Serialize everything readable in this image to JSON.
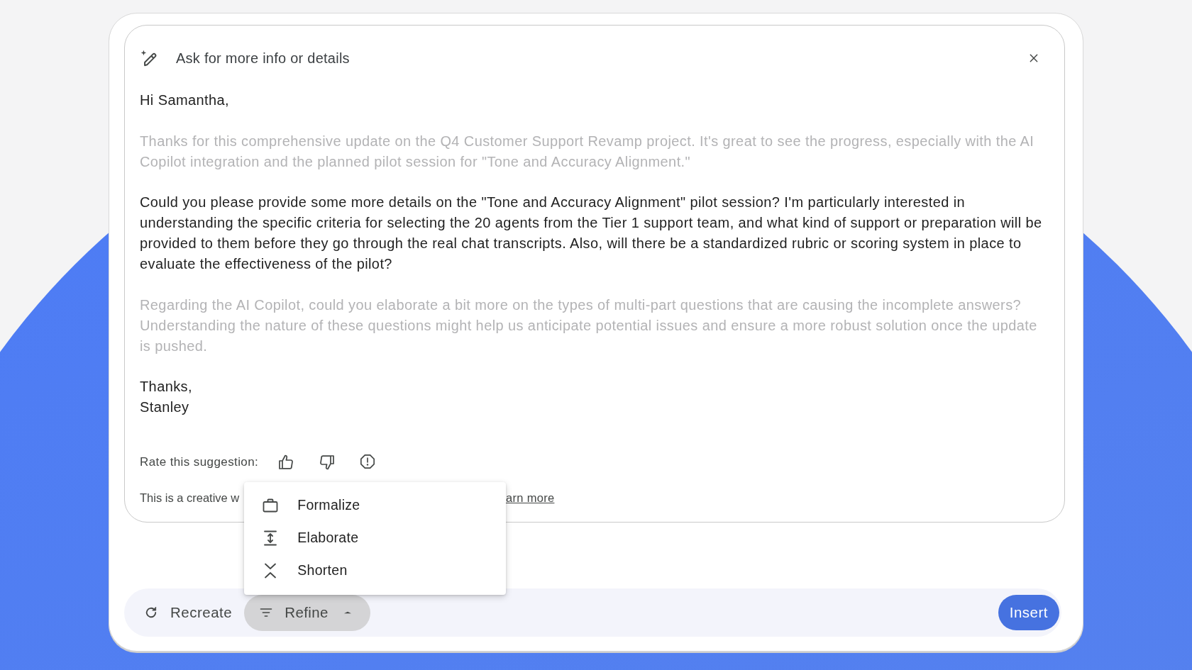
{
  "dialog": {
    "title": "Ask for more info or details"
  },
  "message": {
    "paragraphs": [
      {
        "text": "Hi Samantha,",
        "dimmed": false
      },
      {
        "text": "Thanks for this comprehensive update on the Q4 Customer Support Revamp project. It's great to see the progress, especially with the AI Copilot integration and the planned pilot session for \"Tone and Accuracy Alignment.\"",
        "dimmed": true
      },
      {
        "text": "Could you please provide some more details on the \"Tone and Accuracy Alignment\" pilot session? I'm particularly interested in understanding the specific criteria for selecting the 20 agents from the Tier 1 support team, and what kind of support or preparation will be provided to them before they go through the real chat transcripts. Also, will there be a standardized rubric or scoring system in place to evaluate the effectiveness of the pilot?",
        "dimmed": false
      },
      {
        "text": "Regarding the AI Copilot, could you elaborate a bit more on the types of multi-part questions that are causing the incomplete answers? Understanding the nature of these questions might help us anticipate potential issues and ensure a more robust solution once the update is pushed.",
        "dimmed": true
      }
    ],
    "sign_off": [
      "Thanks,",
      "Stanley"
    ]
  },
  "feedback": {
    "label": "Rate this suggestion:"
  },
  "disclaimer": {
    "text": "This is a creative w",
    "link": "arn more"
  },
  "refine_menu": {
    "items": [
      {
        "label": "Formalize"
      },
      {
        "label": "Elaborate"
      },
      {
        "label": "Shorten"
      }
    ]
  },
  "recreate_button": {
    "label": "Recreate"
  },
  "refine_button": {
    "label": "Refine",
    "expanded": true
  },
  "insert_button": {
    "label": "Insert"
  }
}
